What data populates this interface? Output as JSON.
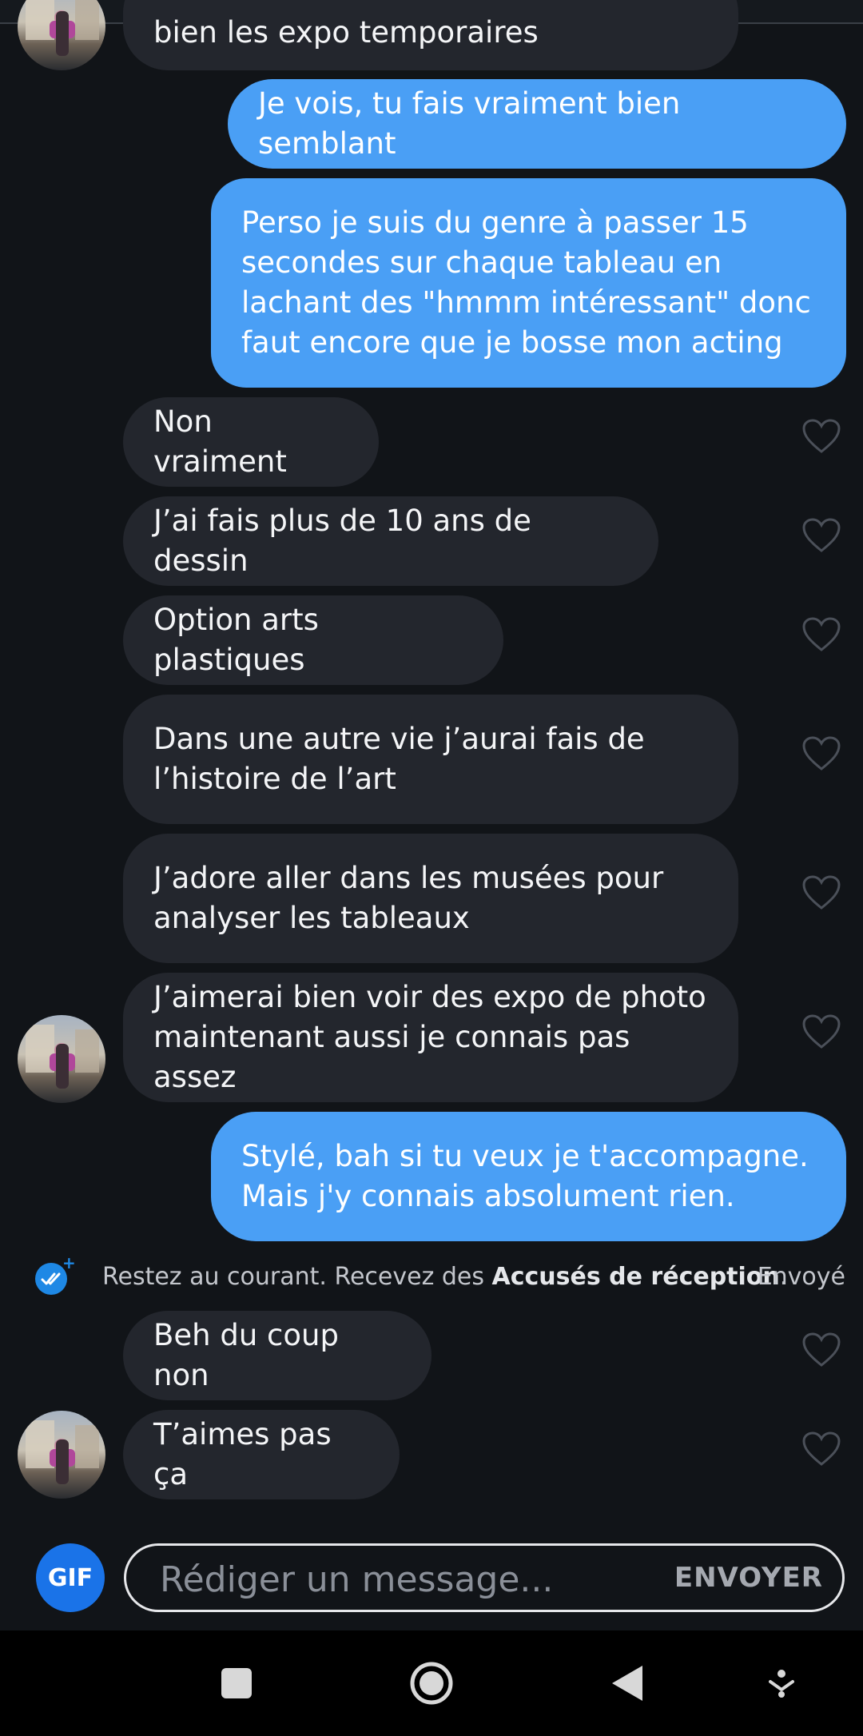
{
  "messages": [
    {
      "dir": "in",
      "text": "bien les expo temporaires"
    },
    {
      "dir": "out",
      "text": "Je vois, tu fais vraiment bien semblant"
    },
    {
      "dir": "out",
      "text": "Perso je suis du genre à passer 15 secondes sur chaque tableau en lachant des \"hmmm intéressant\" donc faut encore que je bosse mon acting"
    },
    {
      "dir": "in",
      "text": "Non vraiment"
    },
    {
      "dir": "in",
      "text": "J’ai fais plus de 10 ans de dessin"
    },
    {
      "dir": "in",
      "text": "Option arts plastiques"
    },
    {
      "dir": "in",
      "text": "Dans une autre vie j’aurai fais de l’histoire de l’art"
    },
    {
      "dir": "in",
      "text": "J’adore aller dans les musées pour analyser les tableaux"
    },
    {
      "dir": "in",
      "text": "J’aimerai bien voir des expo de photo maintenant aussi je connais pas assez"
    },
    {
      "dir": "out",
      "text": "Stylé, bah si tu veux je t'accompagne. Mais j'y connais absolument rien."
    },
    {
      "dir": "in",
      "text": "Beh du coup non"
    },
    {
      "dir": "in",
      "text": "T’aimes pas ça"
    }
  ],
  "receipt": {
    "prefix": "Restez au courant. Recevez des ",
    "link": "Accusés de réception",
    "suffix": ".",
    "status": "Envoyé"
  },
  "composer": {
    "gif_label": "GIF",
    "placeholder": "Rédiger un message...",
    "send_label": "ENVOYER"
  },
  "colors": {
    "background": "#111418",
    "incoming_bubble": "#23262d",
    "outgoing_bubble": "#4a9ff5",
    "accent": "#1a73e8"
  },
  "icons": [
    "heart-icon",
    "double-check-icon",
    "recents-icon",
    "home-icon",
    "back-icon",
    "nav-menu-icon"
  ]
}
